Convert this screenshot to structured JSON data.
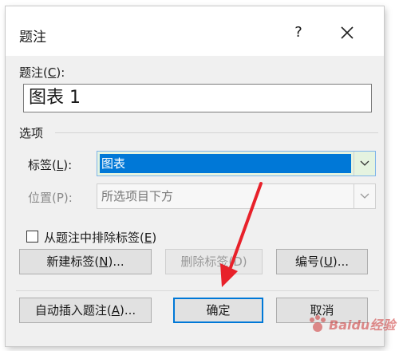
{
  "dialog": {
    "title": "题注",
    "help_label": "?"
  },
  "caption": {
    "label": "题注(",
    "label_key": "C",
    "label_suffix": "):",
    "value": "图表 1"
  },
  "options": {
    "group_label": "选项",
    "label_field": {
      "label": "标签(",
      "key": "L",
      "suffix": "):",
      "value": "图表"
    },
    "position_field": {
      "label": "位置(P):",
      "value": "所选项目下方"
    },
    "exclude_label": {
      "label": "从题注中排除标签(",
      "key": "E",
      "suffix": ")",
      "checked": false
    }
  },
  "buttons": {
    "new_label": {
      "text": "新建标签(",
      "key": "N",
      "suffix": ")..."
    },
    "delete_label": {
      "text": "删除标签(D)"
    },
    "numbering": {
      "text": "编号(",
      "key": "U",
      "suffix": ")..."
    },
    "autocaption": {
      "text": "自动插入题注(",
      "key": "A",
      "suffix": ")..."
    },
    "ok": {
      "text": "确定"
    },
    "cancel": {
      "text": "取消"
    }
  },
  "watermark": {
    "text": "Baidu经验"
  },
  "colors": {
    "selection": "#0078d7",
    "annotation_arrow": "#e8212a",
    "dialog_bg": "#f0f0f0"
  }
}
